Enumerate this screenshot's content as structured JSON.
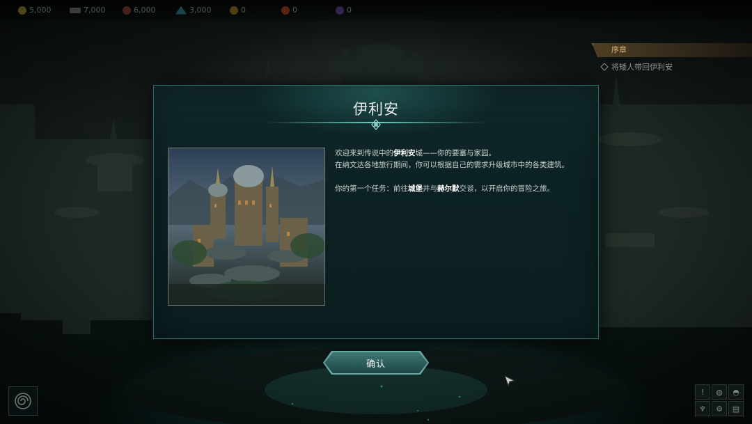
{
  "resources": [
    {
      "icon": "gold-icon",
      "value": "5,000",
      "color": "#8a7a2a"
    },
    {
      "icon": "iron-icon",
      "value": "7,000",
      "color": "#6a6a6a"
    },
    {
      "icon": "ore-icon",
      "value": "6,000",
      "color": "#7a3a2a"
    },
    {
      "icon": "crystal-icon",
      "value": "3,000",
      "color": "#2a7a8a"
    },
    {
      "icon": "coin-icon",
      "value": "0",
      "color": "#8a6a1a"
    },
    {
      "icon": "fire-gem-icon",
      "value": "0",
      "color": "#9a3a1a"
    },
    {
      "icon": "arcane-icon",
      "value": "0",
      "color": "#5a3a8a"
    }
  ],
  "quest": {
    "header": "序章",
    "item": "将矮人带回伊利安"
  },
  "dialog": {
    "title": "伊利安",
    "paragraph1_prefix": "欢迎来到传说中的",
    "paragraph1_bold": "伊利安",
    "paragraph1_suffix": "城——你的要塞与家园。",
    "paragraph2": "在纳文达各地旅行期间，你可以根据自己的需求升级城市中的各类建筑。",
    "paragraph3_prefix": "你的第一个任务：前往",
    "paragraph3_bold1": "城堡",
    "paragraph3_mid": "并与",
    "paragraph3_bold2": "赫尔默",
    "paragraph3_suffix": "交谈，以开启你的冒险之旅。"
  },
  "confirm_label": "确认",
  "bottom_right_buttons": [
    "alert-icon",
    "globe-icon",
    "helmet-icon",
    "faction-icon",
    "settings-icon",
    "save-icon"
  ]
}
